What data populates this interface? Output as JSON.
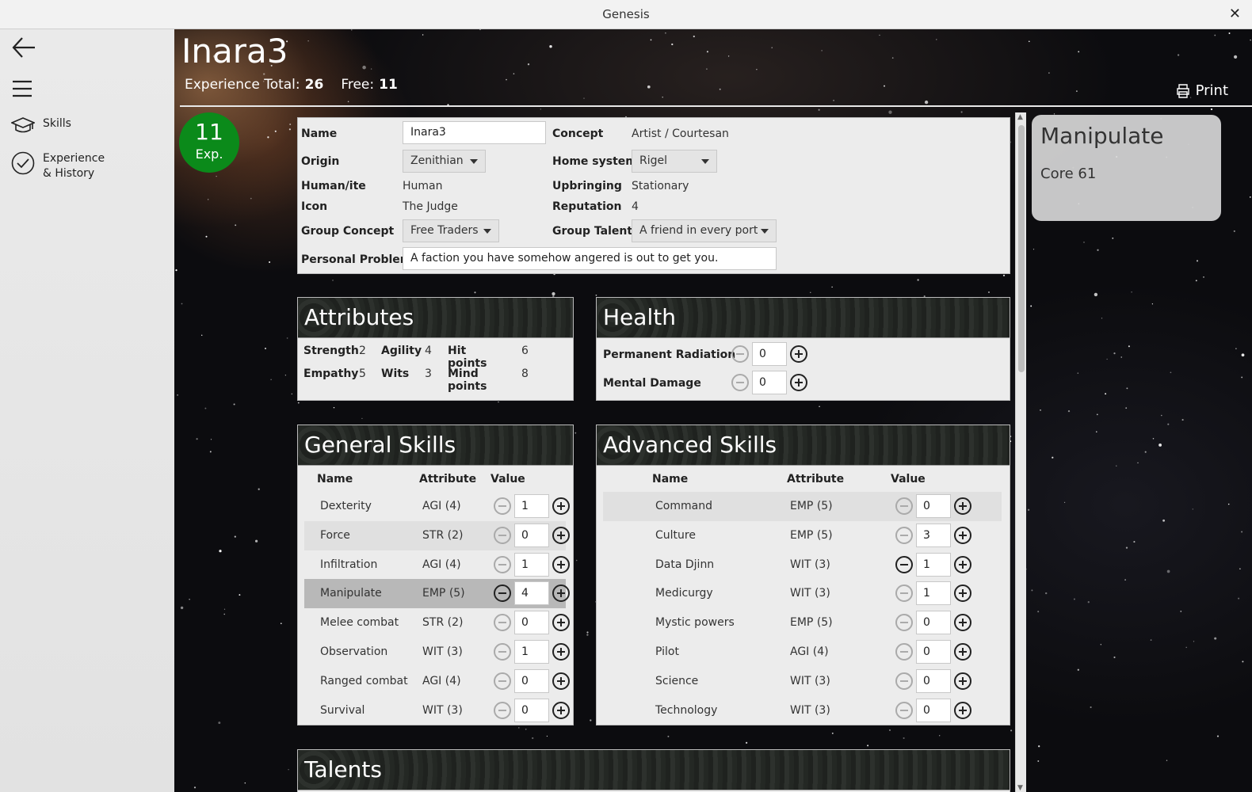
{
  "window": {
    "title": "Genesis"
  },
  "sidebar": {
    "items": [
      {
        "label": "Skills"
      },
      {
        "label_line1": "Experience",
        "label_line2": "& History"
      }
    ]
  },
  "header": {
    "character_name": "Inara3",
    "exp_total_label": "Experience Total:",
    "exp_total": "26",
    "free_label": "Free:",
    "free": "11",
    "print_label": "Print",
    "badge_number": "11",
    "badge_unit": "Exp."
  },
  "info": {
    "name_label": "Name",
    "name_value": "Inara3",
    "concept_label": "Concept",
    "concept_value": "Artist / Courtesan",
    "origin_label": "Origin",
    "origin_value": "Zenithian",
    "home_label": "Home system",
    "home_value": "Rigel",
    "human_label": "Human/ite",
    "human_value": "Human",
    "upbringing_label": "Upbringing",
    "upbringing_value": "Stationary",
    "icon_label": "Icon",
    "icon_value": "The Judge",
    "reputation_label": "Reputation",
    "reputation_value": "4",
    "group_concept_label": "Group Concept",
    "group_concept_value": "Free Traders",
    "group_talent_label": "Group Talent",
    "group_talent_value": "A friend in every port",
    "problem_label": "Personal Problem",
    "problem_value": "A faction you have somehow angered is out to get you."
  },
  "attributes": {
    "title": "Attributes",
    "items": [
      {
        "label": "Strength",
        "value": "2"
      },
      {
        "label": "Agility",
        "value": "4"
      },
      {
        "label": "Hit points",
        "value": "6"
      },
      {
        "label": "Empathy",
        "value": "5"
      },
      {
        "label": "Wits",
        "value": "3"
      },
      {
        "label": "Mind points",
        "value": "8"
      }
    ]
  },
  "health": {
    "title": "Health",
    "rows": [
      {
        "label": "Permanent Radiation",
        "value": "0"
      },
      {
        "label": "Mental Damage",
        "value": "0"
      }
    ]
  },
  "general_skills": {
    "title": "General Skills",
    "col_name": "Name",
    "col_attr": "Attribute",
    "col_value": "Value",
    "rows": [
      {
        "name": "Dexterity",
        "attr": "AGI (4)",
        "value": "1"
      },
      {
        "name": "Force",
        "attr": "STR (2)",
        "value": "0"
      },
      {
        "name": "Infiltration",
        "attr": "AGI (4)",
        "value": "1"
      },
      {
        "name": "Manipulate",
        "attr": "EMP (5)",
        "value": "4"
      },
      {
        "name": "Melee combat",
        "attr": "STR (2)",
        "value": "0"
      },
      {
        "name": "Observation",
        "attr": "WIT (3)",
        "value": "1"
      },
      {
        "name": "Ranged combat",
        "attr": "AGI (4)",
        "value": "0"
      },
      {
        "name": "Survival",
        "attr": "WIT (3)",
        "value": "0"
      }
    ]
  },
  "advanced_skills": {
    "title": "Advanced Skills",
    "col_name": "Name",
    "col_attr": "Attribute",
    "col_value": "Value",
    "rows": [
      {
        "name": "Command",
        "attr": "EMP (5)",
        "value": "0"
      },
      {
        "name": "Culture",
        "attr": "EMP (5)",
        "value": "3"
      },
      {
        "name": "Data Djinn",
        "attr": "WIT (3)",
        "value": "1"
      },
      {
        "name": "Medicurgy",
        "attr": "WIT (3)",
        "value": "1"
      },
      {
        "name": "Mystic powers",
        "attr": "EMP (5)",
        "value": "0"
      },
      {
        "name": "Pilot",
        "attr": "AGI (4)",
        "value": "0"
      },
      {
        "name": "Science",
        "attr": "WIT (3)",
        "value": "0"
      },
      {
        "name": "Technology",
        "attr": "WIT (3)",
        "value": "0"
      }
    ]
  },
  "talents": {
    "title": "Talents"
  },
  "detail": {
    "title": "Manipulate",
    "source": "Core 61"
  },
  "colors": {
    "badge": "#0b8a1a",
    "panel": "#ececec",
    "sidebar": "#e6e6e6"
  }
}
